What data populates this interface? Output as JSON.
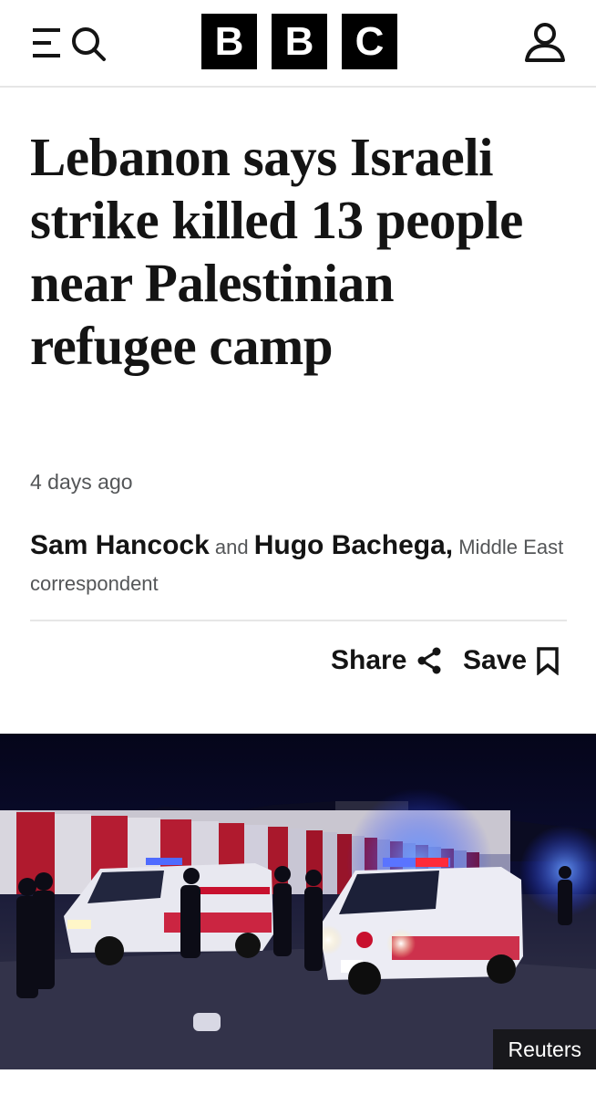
{
  "header": {
    "logo_letters": [
      "B",
      "B",
      "C"
    ],
    "menu_icon": "menu-search-icon",
    "account_icon": "user-icon"
  },
  "article": {
    "headline": "Lebanon says Israeli strike killed 13 people near Palestinian refugee camp",
    "timestamp": "4 days ago",
    "byline": {
      "author1": "Sam Hancock",
      "conjunction": "and",
      "author2": "Hugo Bachega,",
      "role": "Middle East correspondent"
    },
    "actions": {
      "share_label": "Share",
      "share_icon": "share-icon",
      "save_label": "Save",
      "save_icon": "bookmark-icon"
    },
    "image": {
      "credit": "Reuters"
    }
  },
  "colors": {
    "text": "#141414",
    "muted": "#545658",
    "divider": "#e6e6e6",
    "logo_bg": "#000000"
  }
}
